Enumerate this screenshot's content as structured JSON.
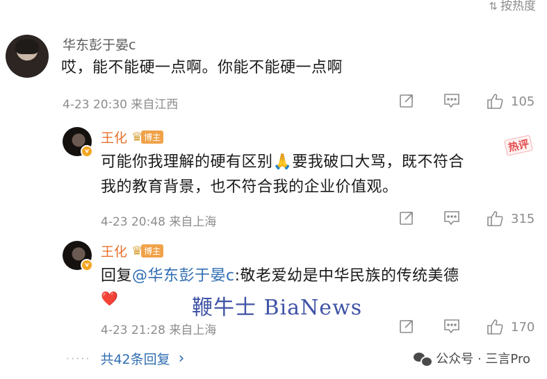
{
  "sort": {
    "icon": "sort-icon",
    "label": "按热度"
  },
  "comments": [
    {
      "user": "华东彭于晏c",
      "text": "哎，能不能硬一点啊。你能不能硬一点啊",
      "time": "4-23 20:30",
      "location": "来自江西",
      "likes": "105"
    }
  ],
  "replies": [
    {
      "user": "王化",
      "badge": "博主",
      "text_line1": "可能你我理解的硬有区别🙏要我破口大骂，既不符合",
      "text_line2": "我的教育背景，也不符合我的企业价值观。",
      "hot_tag": "热评",
      "time": "4-23 20:48",
      "location": "来自上海",
      "likes": "315"
    },
    {
      "user": "王化",
      "badge": "博主",
      "reply_prefix": "回复",
      "mention": "@华东彭于晏c",
      "text_rest": ":敬老爱幼是中华民族的传统美德",
      "emoji": "❤️",
      "time": "4-23 21:28",
      "location": "来自上海",
      "likes": "170"
    }
  ],
  "watermark": "鞭牛士 BiaNews",
  "more_replies": {
    "dots": "·····",
    "label": "共42条回复",
    "chevron": "›"
  },
  "footer_brand": {
    "icon": "wechat-icon",
    "label": "公众号 · 三言Pro"
  },
  "colors": {
    "accent_blue": "#2f6db2",
    "orange_name": "#e8712c",
    "meta_gray": "#8c8c8c",
    "hot_red": "#e44b4b"
  }
}
